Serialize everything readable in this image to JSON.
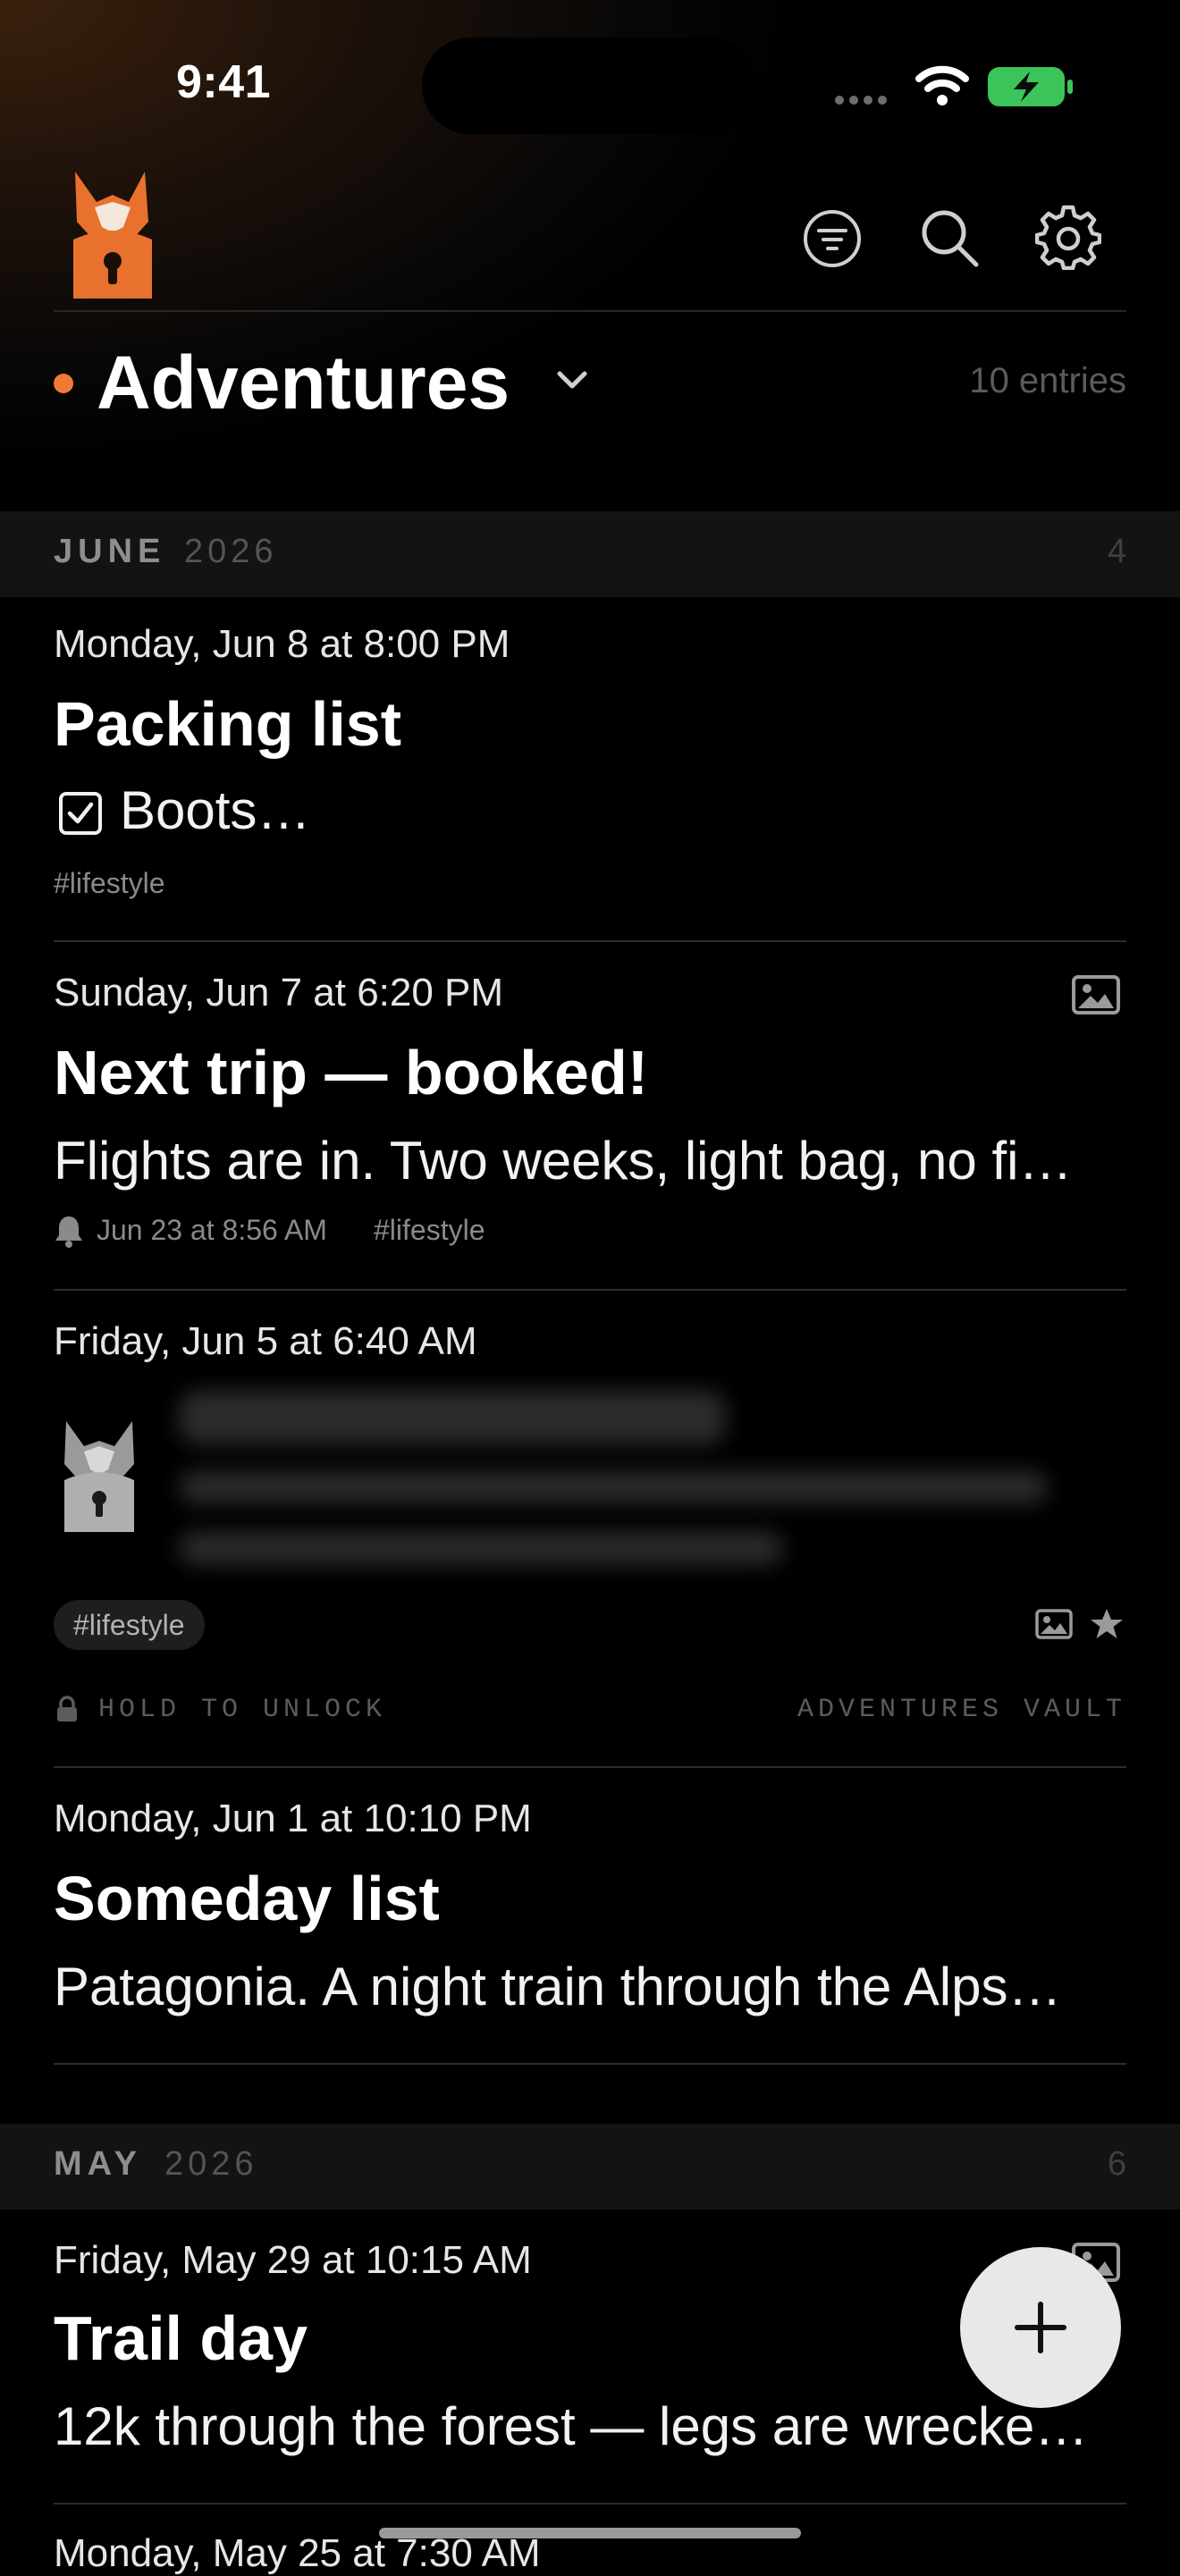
{
  "status_bar": {
    "time": "9:41"
  },
  "header": {
    "journal_title": "Adventures",
    "entry_count": "10 entries",
    "accent_color": "#ef7a36"
  },
  "sections": [
    {
      "month": "JUNE",
      "year": "2026",
      "count": "4"
    },
    {
      "month": "MAY",
      "year": "2026",
      "count": "6"
    }
  ],
  "entries": [
    {
      "date": "Monday, Jun 8 at 8:00 PM",
      "title": "Packing list",
      "preview": "Boots…",
      "tags": "#lifestyle"
    },
    {
      "date": "Sunday, Jun 7 at 6:20 PM",
      "title": "Next trip — booked!",
      "preview": "Flights are in. Two weeks, light bag, no fi…",
      "reminder": "Jun 23 at 8:56 AM",
      "tags": "#lifestyle"
    },
    {
      "date": "Friday, Jun 5 at 6:40 AM",
      "tag_chip": "#lifestyle",
      "lock_hint": "HOLD TO UNLOCK",
      "vault": "ADVENTURES VAULT"
    },
    {
      "date": "Monday, Jun 1 at 10:10 PM",
      "title": "Someday list",
      "preview": "Patagonia. A night train through the Alps…"
    },
    {
      "date": "Friday, May 29 at 10:15 AM",
      "title": "Trail day",
      "preview": "12k through the forest — legs are wrecke…"
    },
    {
      "date": "Monday, May 25 at 7:30 AM"
    }
  ]
}
